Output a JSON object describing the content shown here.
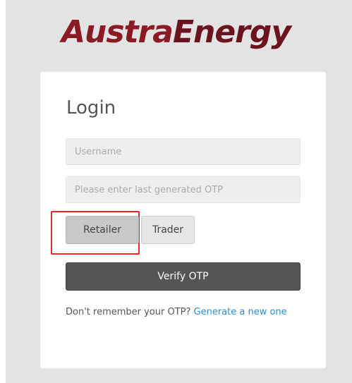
{
  "brand": {
    "name_part1": "Austra",
    "name_part2": "Energy"
  },
  "login": {
    "title": "Login",
    "username_placeholder": "Username",
    "otp_placeholder": "Please enter last generated OTP",
    "roles": {
      "retailer": "Retailer",
      "trader": "Trader",
      "selected": "Retailer"
    },
    "verify_label": "Verify OTP",
    "help_text": "Don't remember your OTP? ",
    "help_link": "Generate a new one"
  },
  "colors": {
    "brand_red": "#8a1a24",
    "highlight": "#e8262c",
    "link": "#2a8fc4",
    "button_dark": "#555555"
  }
}
